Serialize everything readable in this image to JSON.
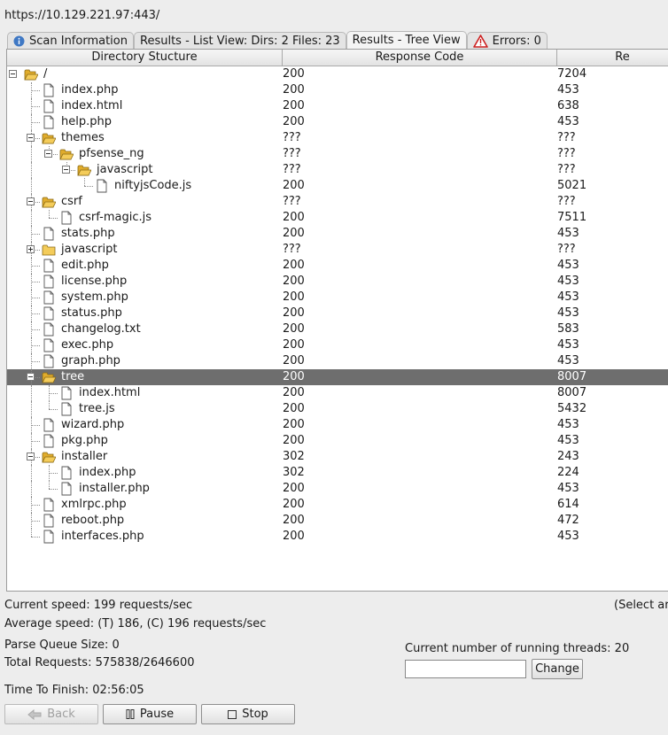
{
  "url": "https://10.129.221.97:443/",
  "tabs": [
    {
      "label": "Scan Information",
      "icon": "info-icon",
      "active": false
    },
    {
      "label": "Results - List View: Dirs: 2 Files: 23",
      "icon": "",
      "active": false
    },
    {
      "label": "Results - Tree View",
      "icon": "",
      "active": true
    },
    {
      "label": "Errors: 0",
      "icon": "warning-icon",
      "active": false
    }
  ],
  "table": {
    "headers": [
      "Directory Stucture",
      "Response Code",
      "Re"
    ],
    "rows": [
      {
        "name": "/",
        "type": "folder",
        "depth": 0,
        "code": "200",
        "size": "7204",
        "toggle": "minus"
      },
      {
        "name": "index.php",
        "type": "file",
        "depth": 1,
        "code": "200",
        "size": "453"
      },
      {
        "name": "index.html",
        "type": "file",
        "depth": 1,
        "code": "200",
        "size": "638"
      },
      {
        "name": "help.php",
        "type": "file",
        "depth": 1,
        "code": "200",
        "size": "453"
      },
      {
        "name": "themes",
        "type": "folder",
        "depth": 1,
        "code": "???",
        "size": "???",
        "toggle": "minus"
      },
      {
        "name": "pfsense_ng",
        "type": "folder",
        "depth": 2,
        "code": "???",
        "size": "???",
        "toggle": "minus"
      },
      {
        "name": "javascript",
        "type": "folder",
        "depth": 3,
        "code": "???",
        "size": "???",
        "toggle": "minus"
      },
      {
        "name": "niftyjsCode.js",
        "type": "file",
        "depth": 4,
        "code": "200",
        "size": "5021"
      },
      {
        "name": "csrf",
        "type": "folder",
        "depth": 1,
        "code": "???",
        "size": "???",
        "toggle": "minus"
      },
      {
        "name": "csrf-magic.js",
        "type": "file",
        "depth": 2,
        "code": "200",
        "size": "7511"
      },
      {
        "name": "stats.php",
        "type": "file",
        "depth": 1,
        "code": "200",
        "size": "453"
      },
      {
        "name": "javascript",
        "type": "folder-closed",
        "depth": 1,
        "code": "???",
        "size": "???",
        "toggle": "plus"
      },
      {
        "name": "edit.php",
        "type": "file",
        "depth": 1,
        "code": "200",
        "size": "453"
      },
      {
        "name": "license.php",
        "type": "file",
        "depth": 1,
        "code": "200",
        "size": "453"
      },
      {
        "name": "system.php",
        "type": "file",
        "depth": 1,
        "code": "200",
        "size": "453"
      },
      {
        "name": "status.php",
        "type": "file",
        "depth": 1,
        "code": "200",
        "size": "453"
      },
      {
        "name": "changelog.txt",
        "type": "file",
        "depth": 1,
        "code": "200",
        "size": "583"
      },
      {
        "name": "exec.php",
        "type": "file",
        "depth": 1,
        "code": "200",
        "size": "453"
      },
      {
        "name": "graph.php",
        "type": "file",
        "depth": 1,
        "code": "200",
        "size": "453"
      },
      {
        "name": "tree",
        "type": "folder",
        "depth": 1,
        "code": "200",
        "size": "8007",
        "toggle": "minus",
        "selected": true
      },
      {
        "name": "index.html",
        "type": "file",
        "depth": 2,
        "code": "200",
        "size": "8007"
      },
      {
        "name": "tree.js",
        "type": "file",
        "depth": 2,
        "code": "200",
        "size": "5432"
      },
      {
        "name": "wizard.php",
        "type": "file",
        "depth": 1,
        "code": "200",
        "size": "453"
      },
      {
        "name": "pkg.php",
        "type": "file",
        "depth": 1,
        "code": "200",
        "size": "453"
      },
      {
        "name": "installer",
        "type": "folder",
        "depth": 1,
        "code": "302",
        "size": "243",
        "toggle": "minus"
      },
      {
        "name": "index.php",
        "type": "file",
        "depth": 2,
        "code": "302",
        "size": "224"
      },
      {
        "name": "installer.php",
        "type": "file",
        "depth": 2,
        "code": "200",
        "size": "453"
      },
      {
        "name": "xmlrpc.php",
        "type": "file",
        "depth": 1,
        "code": "200",
        "size": "614"
      },
      {
        "name": "reboot.php",
        "type": "file",
        "depth": 1,
        "code": "200",
        "size": "472"
      },
      {
        "name": "interfaces.php",
        "type": "file",
        "depth": 1,
        "code": "200",
        "size": "453"
      }
    ]
  },
  "status": {
    "current_speed": "Current speed: 199 requests/sec",
    "average_speed": "Average speed: (T) 186, (C) 196 requests/sec",
    "parse_queue": "Parse Queue Size: 0",
    "total_requests": "Total Requests: 575838/2646600",
    "time_to_finish": "Time To Finish: 02:56:05",
    "select_hint": "(Select ar"
  },
  "threads": {
    "label": "Current number of running threads: 20",
    "input_value": "",
    "change_label": "Change"
  },
  "buttons": {
    "back": "Back",
    "pause": "Pause",
    "stop": "Stop"
  },
  "colors": {
    "selected_row": "#6e6e6e",
    "folder": "#f0c24a",
    "warning": "#cc1f1f",
    "info": "#3f78c4"
  }
}
